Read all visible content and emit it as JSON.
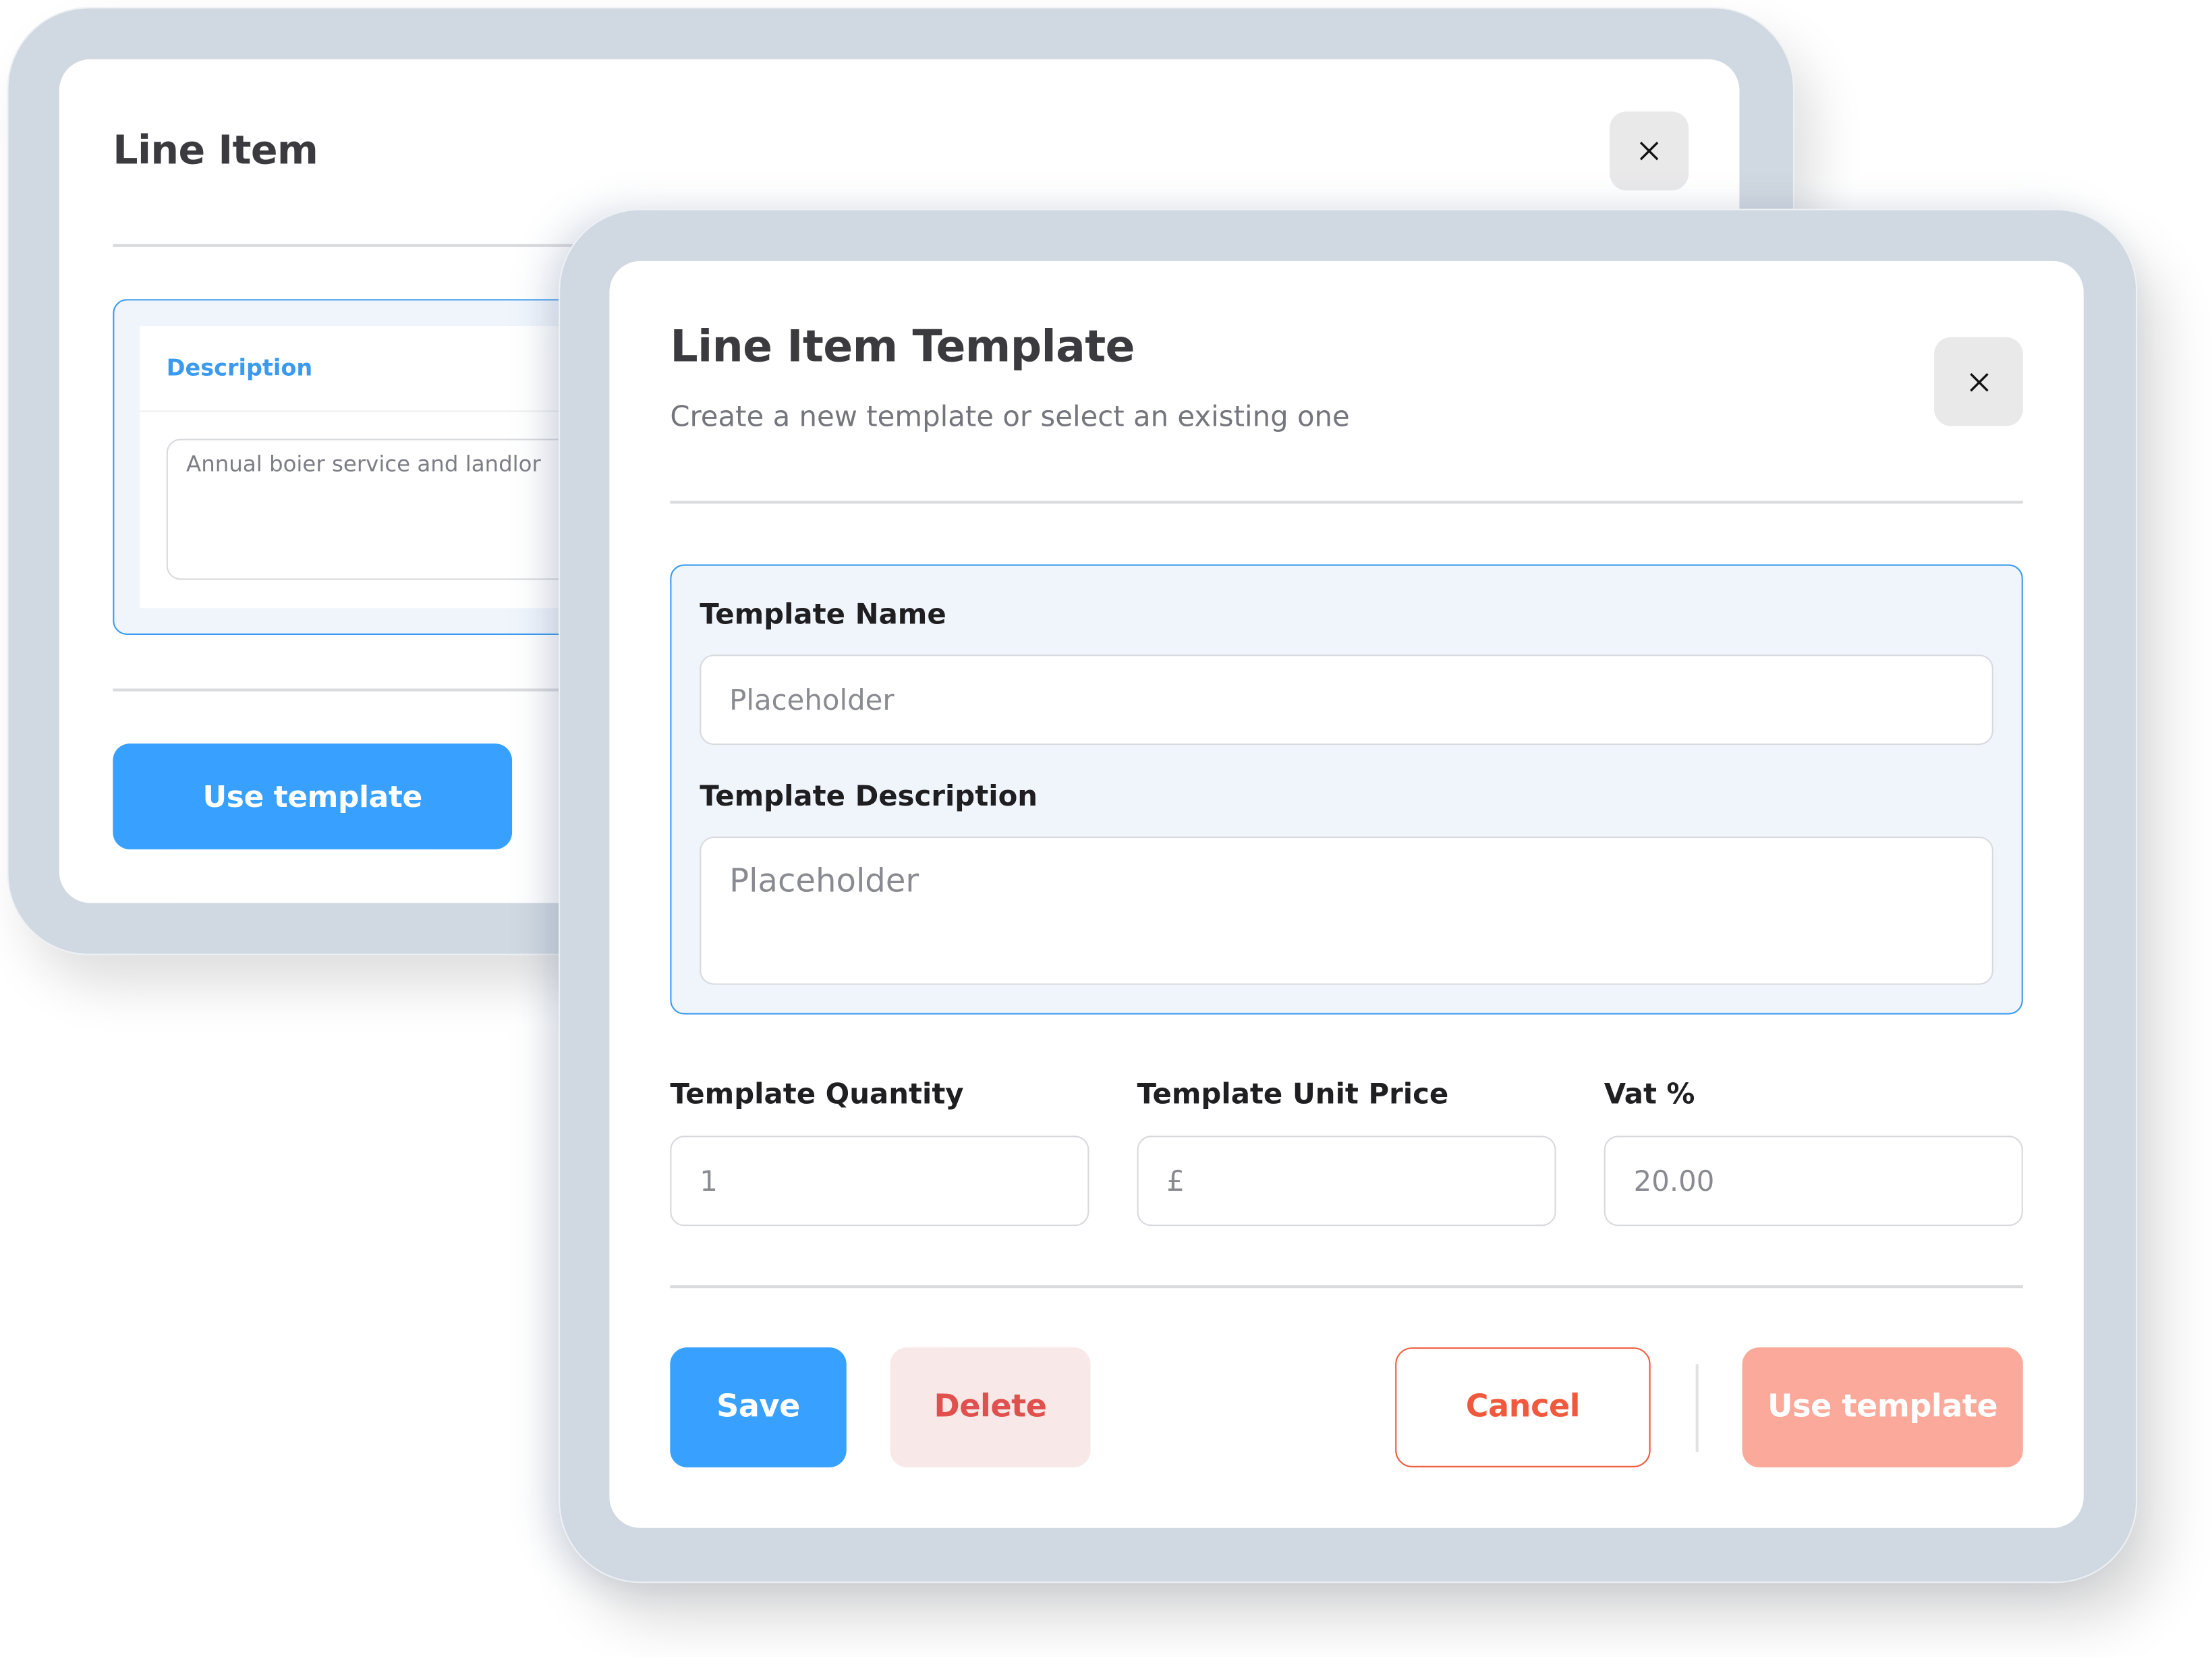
{
  "back_modal": {
    "title": "Line Item",
    "close_icon": "close-icon",
    "description_label": "Description",
    "description_value": "Annual boier service and landlor",
    "use_template_label": "Use template"
  },
  "front_modal": {
    "title": "Line Item Template",
    "subtitle": "Create a new template or select an existing one",
    "close_icon": "close-icon",
    "template_name": {
      "label": "Template Name",
      "placeholder": "Placeholder"
    },
    "template_description": {
      "label": "Template Description",
      "placeholder": "Placeholder"
    },
    "quantity": {
      "label": "Template Quantity",
      "value": "1"
    },
    "unit_price": {
      "label": "Template Unit Price",
      "value": "£"
    },
    "vat": {
      "label": "Vat %",
      "value": "20.00"
    },
    "buttons": {
      "save": "Save",
      "delete": "Delete",
      "cancel": "Cancel",
      "use_template": "Use template"
    }
  },
  "colors": {
    "primary_blue": "#38a1ff",
    "danger_red": "#ef5a3c",
    "danger_soft_bg": "#f9e8e8",
    "delete_text": "#e0504e",
    "use_template_disabled": "#faa99a",
    "section_bg": "#f0f5fc",
    "section_border": "#3a9af0"
  }
}
